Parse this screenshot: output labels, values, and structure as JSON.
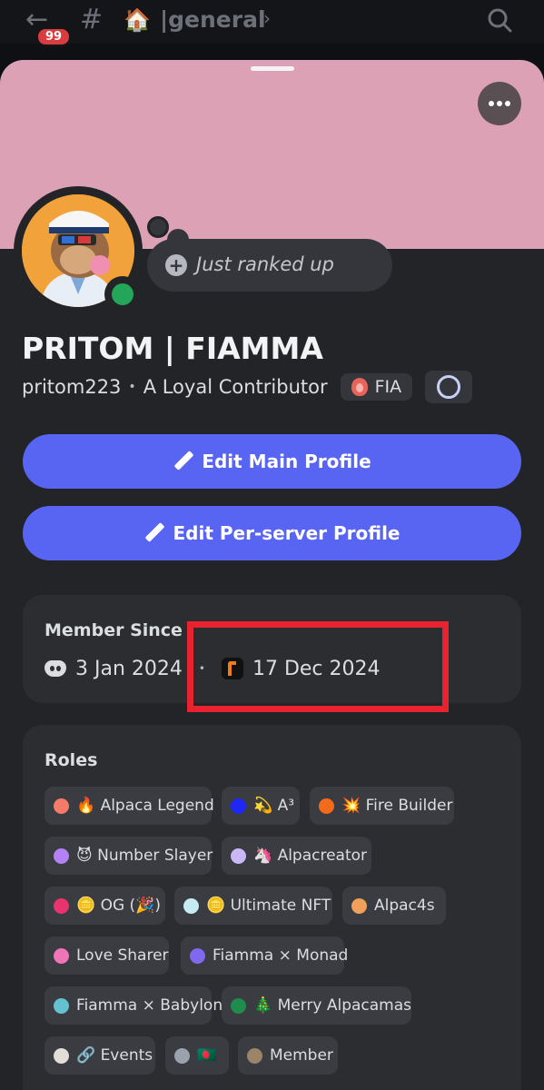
{
  "header": {
    "back_icon": "back-arrow-icon",
    "unread_badge": "99",
    "channel_prefix_icon": "hash-icon",
    "channel_emoji": "🏠",
    "channel_name": "general",
    "chevron_icon": "chevron-right-icon",
    "search_icon": "search-icon"
  },
  "profile": {
    "banner_color": "#dca1b5",
    "more_icon": "more-icon",
    "status_color": "#23a55a",
    "custom_status": "Just ranked up",
    "display_name": "PRITOM | FIAMMA",
    "username": "pritom223",
    "separator": "•",
    "pronouns": "A Loyal Contributor",
    "server_tag": "FIA",
    "edit_main_label": "Edit Main Profile",
    "edit_server_label": "Edit Per-server Profile"
  },
  "member_since": {
    "title": "Member Since",
    "discord_date": "3 Jan 2024",
    "separator": "•",
    "server_date": "17 Dec 2024",
    "highlight_color": "#e8222f"
  },
  "roles": {
    "title": "Roles",
    "items": [
      {
        "label": "🔥 Alpaca Legend",
        "color": "#f47b67"
      },
      {
        "label": "💫 A³",
        "color": "#1f27f5"
      },
      {
        "label": "💥 Fire Builder",
        "color": "#f26a1b"
      },
      {
        "label": "😈 Number Slayer",
        "color": "#b482f5"
      },
      {
        "label": "🦄 Alpacreator",
        "color": "#c9b8f5"
      },
      {
        "label": "🪙 OG (🎉)",
        "color": "#e8336f"
      },
      {
        "label": "🪙 Ultimate NFT",
        "color": "#c6ecf2"
      },
      {
        "label": "Alpac4s",
        "color": "#f0a05a"
      },
      {
        "label": "Love Sharer",
        "color": "#f075b8"
      },
      {
        "label": "Fiamma × Monad",
        "color": "#8069f0"
      },
      {
        "label": "Fiamma × Babylon",
        "color": "#62c2cf"
      },
      {
        "label": "🎄 Merry Alpacamas",
        "color": "#1f8b4c"
      },
      {
        "label": "🔗 Events",
        "color": "#e2ddd6"
      },
      {
        "label": "🇧🇩",
        "color": "#9aa3ad"
      },
      {
        "label": "Member",
        "color": "#9c8468"
      }
    ]
  }
}
